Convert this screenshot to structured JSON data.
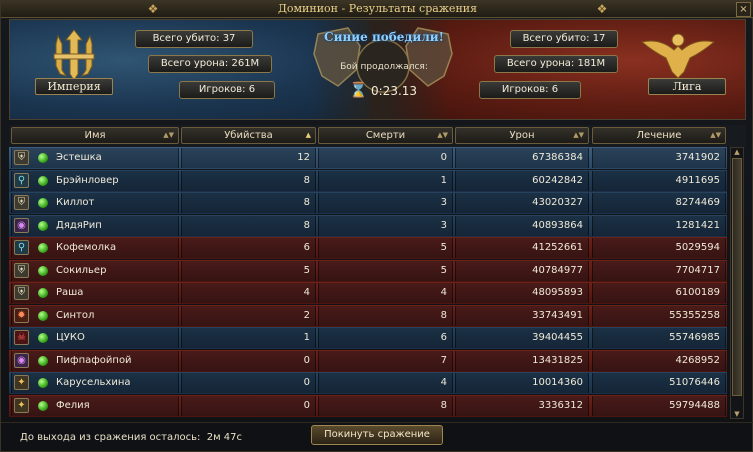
{
  "window": {
    "title": "Доминион - Результаты сражения",
    "close_label": "×"
  },
  "header": {
    "blue": {
      "faction": "Империя",
      "total_killed": "Всего убито: 37",
      "total_damage": "Всего урона: 261M",
      "players": "Игроков: 6"
    },
    "red": {
      "faction": "Лига",
      "total_killed": "Всего убито: 17",
      "total_damage": "Всего урона: 181M",
      "players": "Игроков: 6"
    },
    "winner": "Синие победили!",
    "duration_label": "Бой продолжался:",
    "duration": "0:23.13"
  },
  "columns": {
    "name": "Имя",
    "kills": "Убийства",
    "deaths": "Смерти",
    "damage": "Урон",
    "healing": "Лечение"
  },
  "rows": [
    {
      "team": "blue",
      "selected": true,
      "icon": "shield-icon",
      "name": "Эстешка",
      "kills": "12",
      "deaths": "0",
      "damage": "67386384",
      "healing": "3741902"
    },
    {
      "team": "blue",
      "selected": false,
      "icon": "staff-icon",
      "name": "Брэйнловер",
      "kills": "8",
      "deaths": "1",
      "damage": "60242842",
      "healing": "4911695"
    },
    {
      "team": "blue",
      "selected": false,
      "icon": "shield-icon",
      "name": "Киллот",
      "kills": "8",
      "deaths": "3",
      "damage": "43020327",
      "healing": "8274469"
    },
    {
      "team": "blue",
      "selected": false,
      "icon": "eye-icon",
      "name": "ДядяРип",
      "kills": "8",
      "deaths": "3",
      "damage": "40893864",
      "healing": "1281421"
    },
    {
      "team": "red",
      "selected": false,
      "icon": "staff-icon",
      "name": "Кофемолка",
      "kills": "6",
      "deaths": "5",
      "damage": "41252661",
      "healing": "5029594"
    },
    {
      "team": "red",
      "selected": false,
      "icon": "shield-icon",
      "name": "Сокильер",
      "kills": "5",
      "deaths": "5",
      "damage": "40784977",
      "healing": "7704717"
    },
    {
      "team": "red",
      "selected": false,
      "icon": "shield-icon",
      "name": "Раша",
      "kills": "4",
      "deaths": "4",
      "damage": "48095893",
      "healing": "6100189"
    },
    {
      "team": "red",
      "selected": false,
      "icon": "flame-icon",
      "name": "Синтол",
      "kills": "2",
      "deaths": "8",
      "damage": "33743491",
      "healing": "55355258"
    },
    {
      "team": "blue",
      "selected": false,
      "icon": "skull-icon",
      "name": "ЦУКО",
      "kills": "1",
      "deaths": "6",
      "damage": "39404455",
      "healing": "55746985"
    },
    {
      "team": "red",
      "selected": false,
      "icon": "eye-icon",
      "name": "Пифпафойпой",
      "kills": "0",
      "deaths": "7",
      "damage": "13431825",
      "healing": "4268952"
    },
    {
      "team": "blue",
      "selected": false,
      "icon": "star-icon",
      "name": "Карусельхина",
      "kills": "0",
      "deaths": "4",
      "damage": "10014360",
      "healing": "51076446"
    },
    {
      "team": "red",
      "selected": false,
      "icon": "star-icon",
      "name": "Фелия",
      "kills": "0",
      "deaths": "8",
      "damage": "3336312",
      "healing": "59794488"
    }
  ],
  "footer": {
    "exit_label": "До выхода из сражения осталось:",
    "exit_time": "2м 47с",
    "leave_button": "Покинуть сражение"
  },
  "colors": {
    "blue_row": "#27435e",
    "red_row": "#6e2119",
    "selected_row": "#3e5e7e",
    "winner_text": "#8fd0ff",
    "online_dot": "#39a81c"
  }
}
